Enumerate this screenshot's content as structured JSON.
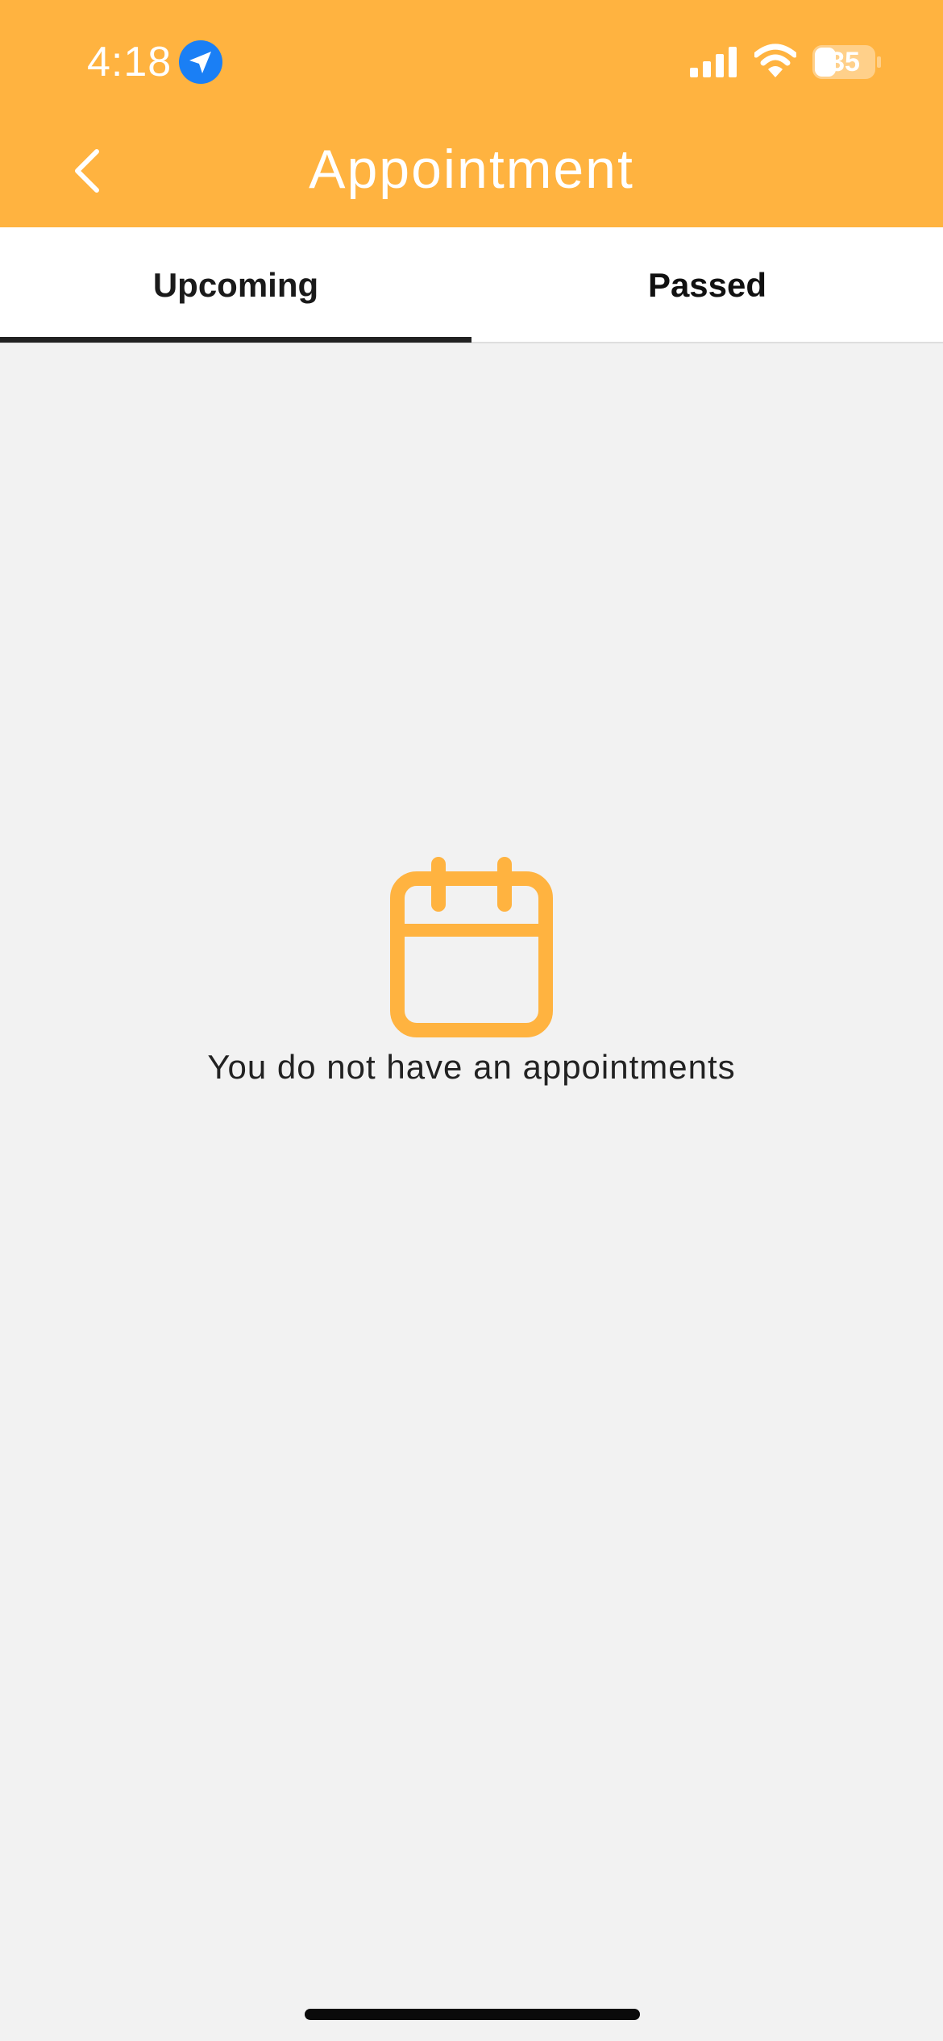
{
  "status_bar": {
    "time": "4:18",
    "battery": "35",
    "icons": [
      "location-arrow-icon",
      "cellular-signal-icon",
      "wifi-icon",
      "battery-icon"
    ]
  },
  "header": {
    "title": "Appointment",
    "back_icon": "chevron-left-icon"
  },
  "tabs": [
    {
      "label": "Upcoming",
      "selected": true
    },
    {
      "label": "Passed",
      "selected": false
    }
  ],
  "empty_state": {
    "icon": "calendar-icon",
    "message": "You do not have an appointments"
  },
  "colors": {
    "accent": "#ffb340",
    "background": "#f2f2f2",
    "location_badge": "#1a7ff5",
    "tab_indicator": "#222222"
  }
}
